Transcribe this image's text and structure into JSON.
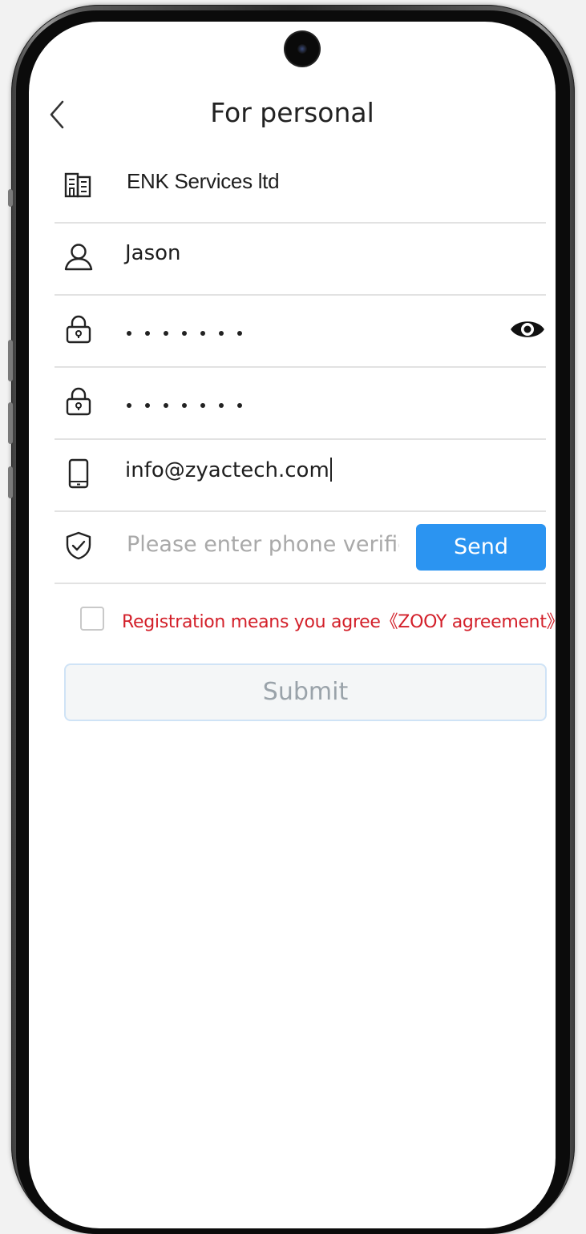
{
  "header": {
    "title": "For personal",
    "back_icon": "chevron-left-icon"
  },
  "form": {
    "company": {
      "icon": "building-icon",
      "value": "ENK Services ltd"
    },
    "username": {
      "icon": "user-icon",
      "value": "Jason"
    },
    "password": {
      "icon": "lock-icon",
      "masked_length": 7,
      "toggle_icon": "eye-icon"
    },
    "confirm_password": {
      "icon": "lock-icon",
      "masked_length": 7
    },
    "email": {
      "icon": "phone-device-icon",
      "value": "info@zyactech.com"
    },
    "verification": {
      "icon": "shield-check-icon",
      "placeholder": "Please enter phone verificati",
      "send_label": "Send"
    }
  },
  "agreement": {
    "checked": false,
    "text": "Registration means you agree",
    "link": "《ZOOY agreement》",
    "color": "#d3202a"
  },
  "submit": {
    "label": "Submit",
    "enabled": false
  },
  "colors": {
    "accent": "#2b94f1",
    "divider": "#e2e2e2"
  }
}
